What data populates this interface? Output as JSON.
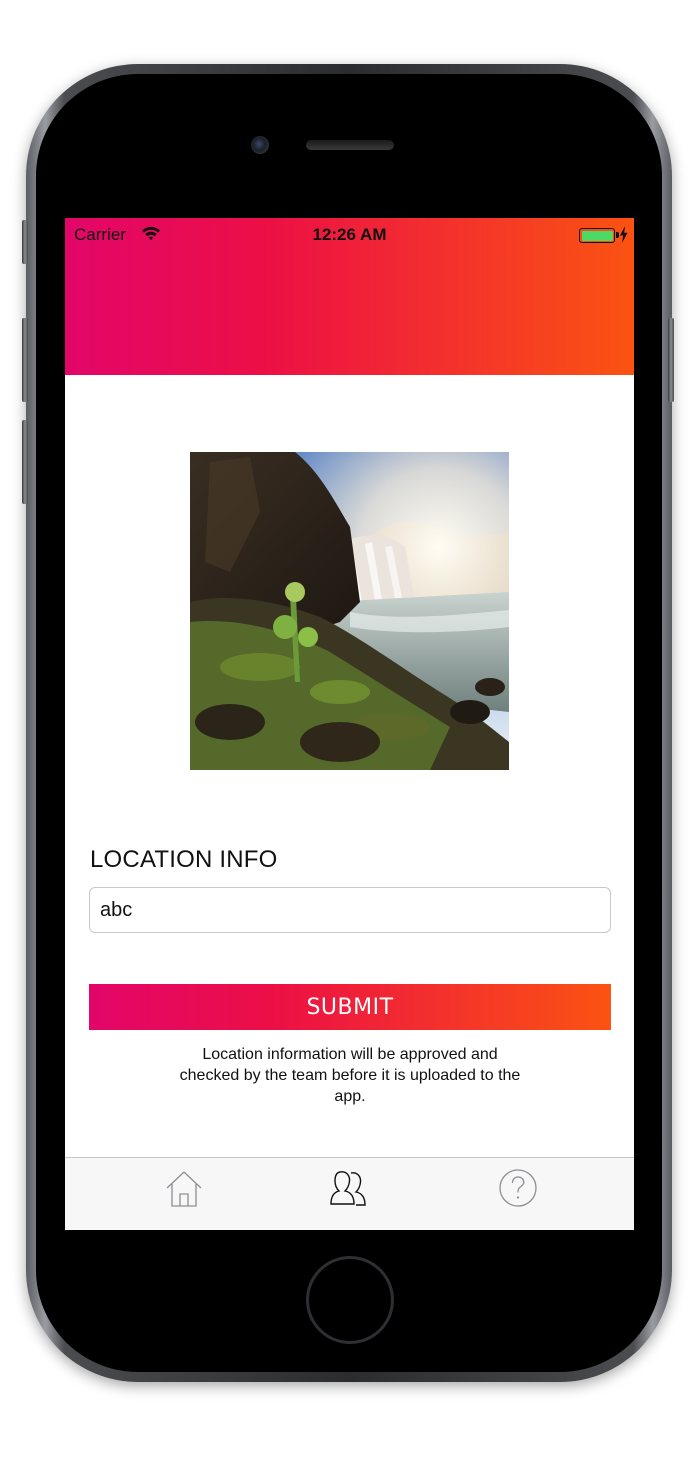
{
  "status_bar": {
    "carrier": "Carrier",
    "time": "12:26 AM",
    "wifi_icon": "wifi-icon",
    "battery_icon": "battery-icon",
    "charging_icon": "bolt-icon"
  },
  "header": {
    "gradient": [
      "#e2066a",
      "#ec0f46",
      "#fb5312"
    ]
  },
  "photo": {
    "subject": "waterfall-image"
  },
  "form": {
    "label": "LOCATION INFO",
    "input_value": "abc",
    "input_placeholder": ""
  },
  "submit": {
    "label": "SUBMIT"
  },
  "note": {
    "text": "Location information will be approved and checked by the team before it is uploaded to the app."
  },
  "tab_bar": {
    "items": [
      {
        "icon": "home-icon",
        "active": false
      },
      {
        "icon": "users-icon",
        "active": true
      },
      {
        "icon": "help-icon",
        "active": false
      }
    ]
  },
  "colors": {
    "accent_start": "#e2066a",
    "accent_end": "#fb5312",
    "battery": "#4cd964"
  }
}
